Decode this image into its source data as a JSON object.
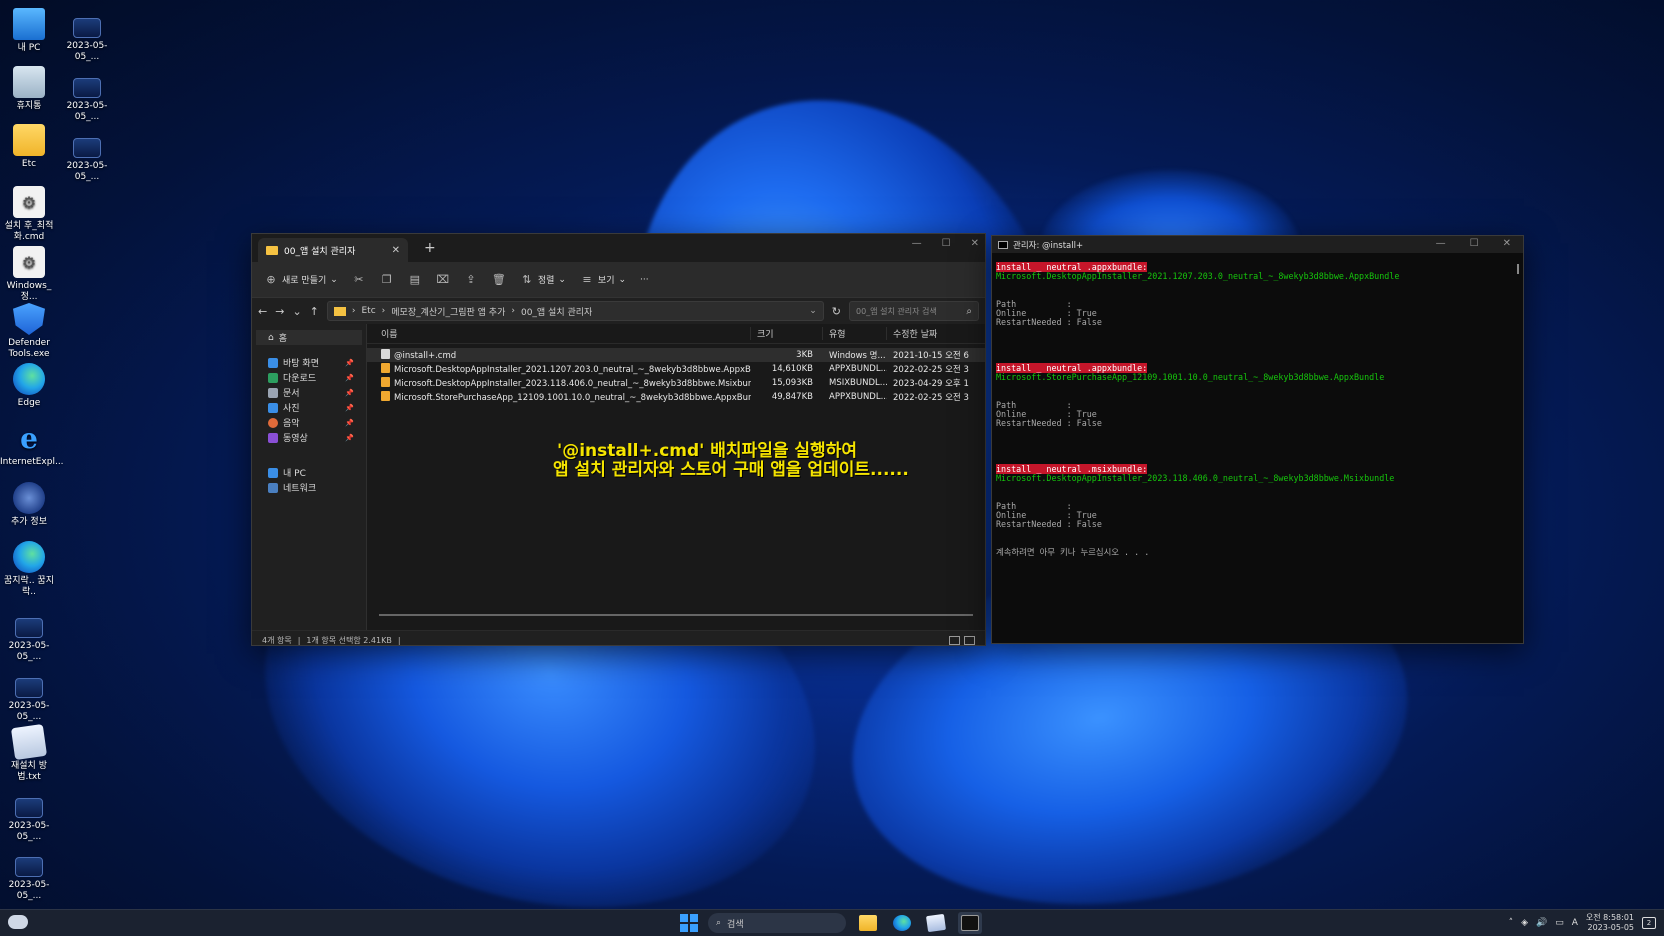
{
  "desktop": {
    "icons": [
      {
        "label": "내 PC"
      },
      {
        "label": "휴지통"
      },
      {
        "label": "Etc"
      },
      {
        "label": "설치 후_최적화.cmd"
      },
      {
        "label": "Windows_정..."
      },
      {
        "label": "Defender Tools.exe"
      },
      {
        "label": "Edge"
      },
      {
        "label": "InternetExpl..."
      },
      {
        "label": "추가 정보"
      },
      {
        "label": "꿈지락.. 꿈지락.."
      },
      {
        "label": "2023-05-05_..."
      },
      {
        "label": "2023-05-05_..."
      },
      {
        "label": "재설치 방법.txt"
      },
      {
        "label": "2023-05-05_..."
      },
      {
        "label": "2023-05-05_..."
      }
    ],
    "col2_icons": [
      {
        "label": "2023-05-05_..."
      },
      {
        "label": "2023-05-05_..."
      },
      {
        "label": "2023-05-05_..."
      }
    ]
  },
  "explorer": {
    "tab_title": "00_앱 설치 관리자",
    "toolbar": {
      "new_label": "새로 만들기",
      "sort_label": "정렬",
      "view_label": "보기",
      "more_label": "···"
    },
    "breadcrumb": [
      "Etc",
      "메모장_계산기_그림판 앱 추가",
      "00_앱 설치 관리자"
    ],
    "search_placeholder": "00_앱 설치 관리자 검색",
    "nav": {
      "home": "홈",
      "quick": [
        "바탕 화면",
        "다운로드",
        "문서",
        "사진",
        "음악",
        "동영상"
      ],
      "pc": "내 PC",
      "network": "네트워크"
    },
    "columns": {
      "name": "이름",
      "size": "크기",
      "type": "유형",
      "date": "수정한 날짜"
    },
    "files": [
      {
        "name": "@install+.cmd",
        "size": "3KB",
        "type": "Windows 명...",
        "date": "2021-10-15 오전 6..."
      },
      {
        "name": "Microsoft.DesktopAppInstaller_2021.1207.203.0_neutral_~_8wekyb3d8bbwe.AppxBundle",
        "size": "14,610KB",
        "type": "APPXBUNDL...",
        "date": "2022-02-25 오전 3..."
      },
      {
        "name": "Microsoft.DesktopAppInstaller_2023.118.406.0_neutral_~_8wekyb3d8bbwe.Msixbundle",
        "size": "15,093KB",
        "type": "MSIXBUNDL...",
        "date": "2023-04-29 오후 1..."
      },
      {
        "name": "Microsoft.StorePurchaseApp_12109.1001.10.0_neutral_~_8wekyb3d8bbwe.AppxBundle",
        "size": "49,847KB",
        "type": "APPXBUNDL...",
        "date": "2022-02-25 오전 3..."
      }
    ],
    "overlay_line1": "'@install+.cmd' 배치파일을 실행하여",
    "overlay_line2": "앱 설치 관리자와 스토어 구매 앱을 업데이트......",
    "status": {
      "count": "4개 항목",
      "selected": "1개 항목 선택함 2.41KB"
    }
  },
  "console": {
    "title": "관리자: @install+",
    "lines": [
      {
        "t": "install _ neutral .appxbundle:",
        "c": "red"
      },
      {
        "t": "Microsoft.DesktopAppInstaller_2021.1207.203.0_neutral_~_8wekyb3d8bbwe.AppxBundle",
        "c": "green"
      },
      {
        "t": "",
        "c": "gray"
      },
      {
        "t": "",
        "c": "gray"
      },
      {
        "t": "Path          :",
        "c": "gray"
      },
      {
        "t": "Online        : True",
        "c": "gray"
      },
      {
        "t": "RestartNeeded : False",
        "c": "gray"
      },
      {
        "t": "",
        "c": "gray"
      },
      {
        "t": "",
        "c": "gray"
      },
      {
        "t": "",
        "c": "gray"
      },
      {
        "t": "",
        "c": "gray"
      },
      {
        "t": "install _ neutral .appxbundle:",
        "c": "red"
      },
      {
        "t": "Microsoft.StorePurchaseApp_12109.1001.10.0_neutral_~_8wekyb3d8bbwe.AppxBundle",
        "c": "green"
      },
      {
        "t": "",
        "c": "gray"
      },
      {
        "t": "",
        "c": "gray"
      },
      {
        "t": "Path          :",
        "c": "gray"
      },
      {
        "t": "Online        : True",
        "c": "gray"
      },
      {
        "t": "RestartNeeded : False",
        "c": "gray"
      },
      {
        "t": "",
        "c": "gray"
      },
      {
        "t": "",
        "c": "gray"
      },
      {
        "t": "",
        "c": "gray"
      },
      {
        "t": "",
        "c": "gray"
      },
      {
        "t": "install _ neutral .msixbundle:",
        "c": "red"
      },
      {
        "t": "Microsoft.DesktopAppInstaller_2023.118.406.0_neutral_~_8wekyb3d8bbwe.Msixbundle",
        "c": "green"
      },
      {
        "t": "",
        "c": "gray"
      },
      {
        "t": "",
        "c": "gray"
      },
      {
        "t": "Path          :",
        "c": "gray"
      },
      {
        "t": "Online        : True",
        "c": "gray"
      },
      {
        "t": "RestartNeeded : False",
        "c": "gray"
      },
      {
        "t": "",
        "c": "gray"
      },
      {
        "t": "",
        "c": "gray"
      },
      {
        "t": "계속하려면 아무 키나 누르십시오 . . .",
        "c": "gray"
      }
    ]
  },
  "taskbar": {
    "search_label": "검색",
    "clock_time": "오전 8:58:01",
    "clock_date": "2023-05-05",
    "ime": "A"
  }
}
